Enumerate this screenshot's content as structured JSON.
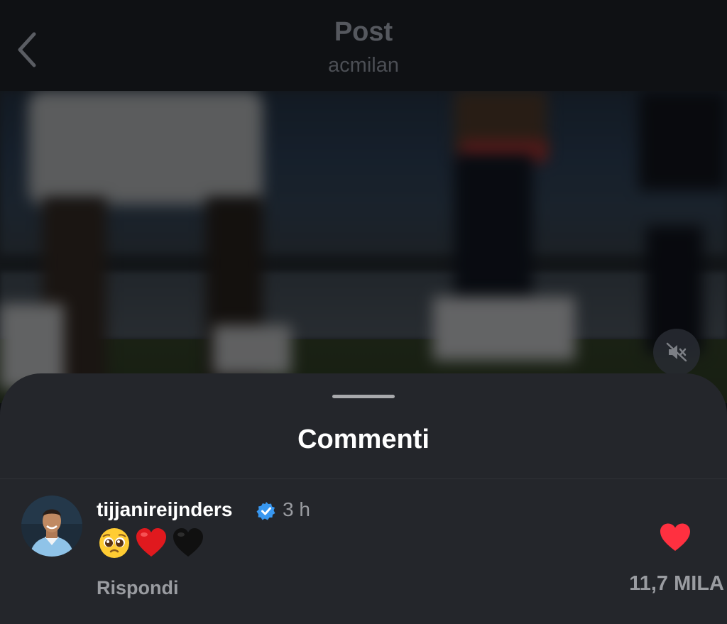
{
  "header": {
    "title": "Post",
    "subtitle": "acmilan"
  },
  "sheet": {
    "title": "Commenti"
  },
  "comment": {
    "username": "tijjanireijnders",
    "time": "3 h",
    "text": "🥺❤️🖤",
    "reply_label": "Rispondi",
    "like_count": "11,7 MILA"
  },
  "icons": [
    "back-chevron-icon",
    "muted-speaker-icon",
    "verified-badge-icon",
    "heart-icon"
  ],
  "colors": {
    "like": "#ff3040",
    "verified": "#3897f0",
    "background": "#24262b"
  }
}
